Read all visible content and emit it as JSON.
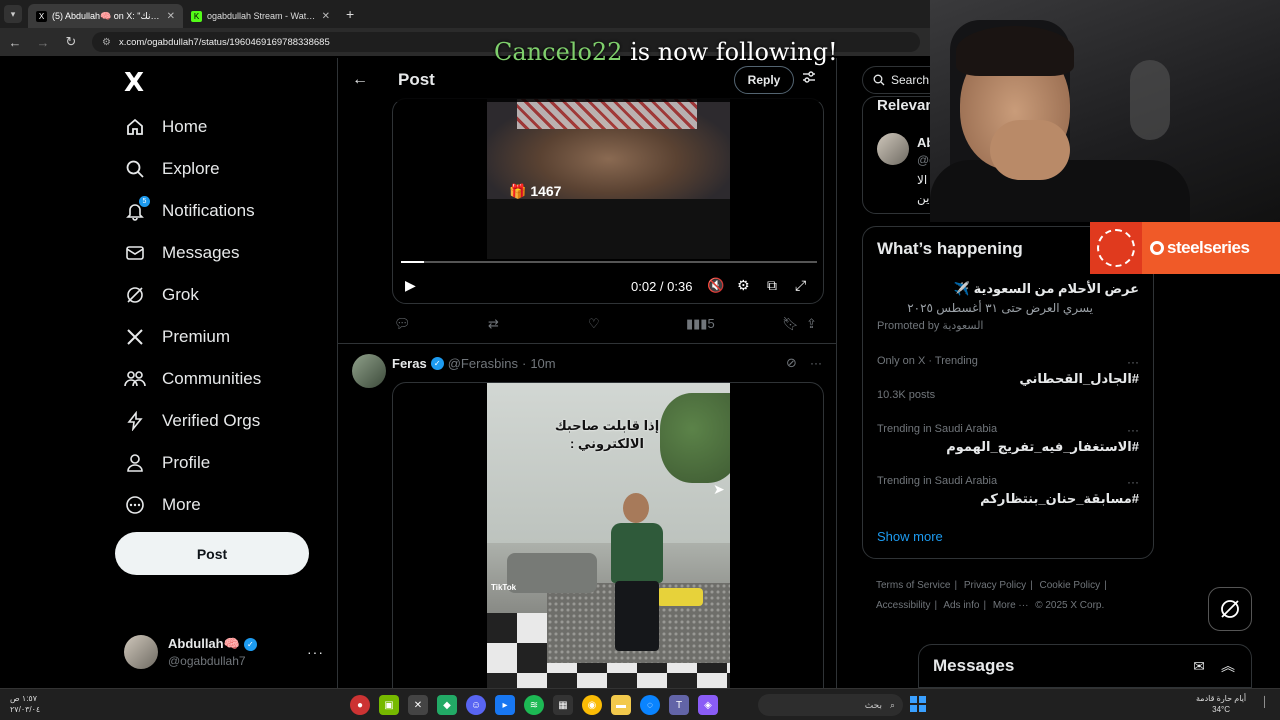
{
  "browser": {
    "tabs": [
      {
        "title": "(5) Abdullah🧠 on X: \"تضع قوانك",
        "active": true
      },
      {
        "title": "ogabdullah Stream - Watch Live",
        "active": false
      }
    ],
    "url": "x.com/ogabdullah7/status/1960469169788338685"
  },
  "overlay": {
    "username": "Cancelo22",
    "text": "is now following!"
  },
  "sidebar": {
    "logo": "X",
    "items": [
      {
        "label": "Home",
        "icon": "home-icon"
      },
      {
        "label": "Explore",
        "icon": "search-icon"
      },
      {
        "label": "Notifications",
        "icon": "bell-icon",
        "badge": "5"
      },
      {
        "label": "Messages",
        "icon": "envelope-icon"
      },
      {
        "label": "Grok",
        "icon": "grok-icon"
      },
      {
        "label": "Premium",
        "icon": "x-icon"
      },
      {
        "label": "Communities",
        "icon": "people-icon"
      },
      {
        "label": "Verified Orgs",
        "icon": "lightning-icon"
      },
      {
        "label": "Profile",
        "icon": "person-icon"
      },
      {
        "label": "More",
        "icon": "more-circle-icon"
      }
    ],
    "post_label": "Post",
    "account": {
      "name": "Abdullah🧠",
      "handle": "@ogabdullah7"
    }
  },
  "main": {
    "title": "Post",
    "reply_label": "Reply",
    "video1": {
      "count": "1467",
      "time": "0:02 / 0:36",
      "progress_fraction": 0.055
    },
    "actions": {
      "views": "5"
    },
    "post2": {
      "name": "Feras",
      "handle": "@Ferasbins",
      "age": "10m",
      "caption": "إذا قابلت صاحبك الالكتروني :",
      "watermark": "TikTok"
    }
  },
  "right": {
    "search_placeholder": "Search",
    "relevant": {
      "heading": "Relevant people",
      "name": "Ab",
      "handle": "@o",
      "bio_line1": "الا",
      "bio_line2": "ين"
    },
    "trends_title": "What’s happening",
    "promo": {
      "title": "عرض الأحلام من السعودية ✈️",
      "subtitle": "يسري العرض حتى ٣١ أغسطس ٢٠٢٥",
      "by": "Promoted by السعودية"
    },
    "trends": [
      {
        "meta": "Only on X · Trending",
        "tag": "#الجادل_القحطاني",
        "posts": "10.3K posts"
      },
      {
        "meta": "Trending in Saudi Arabia",
        "tag": "#الاستغفار_فيه_تفريج_الهموم",
        "posts": ""
      },
      {
        "meta": "Trending in Saudi Arabia",
        "tag": "#مسابقة_حنان_بنتظاركم",
        "posts": ""
      }
    ],
    "show_more": "Show more",
    "footer": [
      "Terms of Service",
      "Privacy Policy",
      "Cookie Policy",
      "Accessibility",
      "Ads info",
      "More ···",
      "© 2025 X Corp."
    ]
  },
  "messages_drawer": {
    "title": "Messages"
  },
  "sponsor": {
    "text": "steelseries"
  },
  "taskbar": {
    "time": "١:٥٧ ص",
    "date": "٢٧/٠٣/٠٤",
    "search_placeholder": "بحث",
    "weather_text": "أيام حارة قادمة",
    "temp": "34°C"
  }
}
